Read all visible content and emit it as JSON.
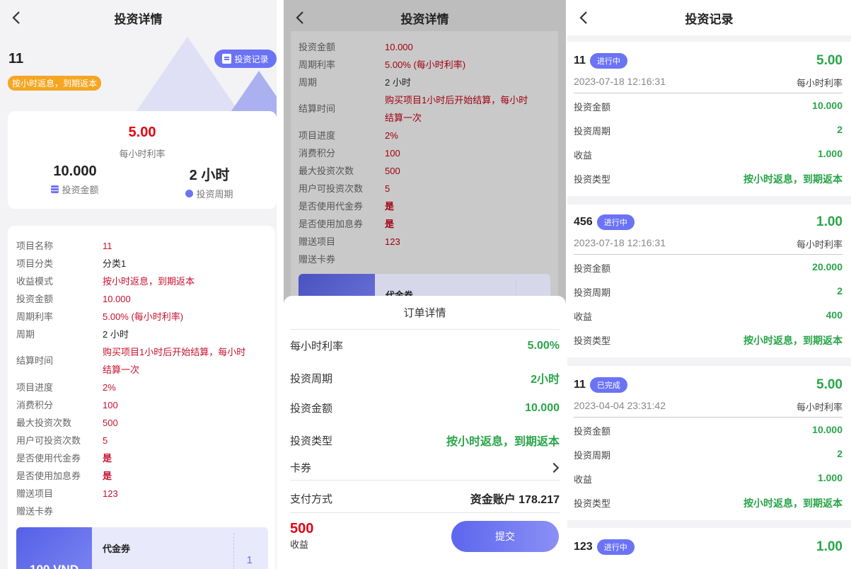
{
  "panel1": {
    "title": "投资详情",
    "name": "11",
    "mode_tag": "按小时返息，到期返本",
    "records_button": "投资记录",
    "rate": "5.00",
    "rate_label": "每小时利率",
    "amount": "10.000",
    "amount_label": "投资金额",
    "period": "2 小时",
    "period_label": "投资周期",
    "details": [
      {
        "k": "项目名称",
        "v": "11"
      },
      {
        "k": "项目分类",
        "v": "分类1"
      },
      {
        "k": "收益模式",
        "v": "按小时返息，到期返本"
      },
      {
        "k": "投资金额",
        "v": "10.000"
      },
      {
        "k": "周期利率",
        "v": "5.00% (每小时利率)"
      },
      {
        "k": "周期",
        "v": "2 小时"
      },
      {
        "k": "结算时间",
        "v1": "购买项目1小时后开始结算，每小时",
        "v2": "结算一次"
      },
      {
        "k": "项目进度",
        "v": "2%"
      },
      {
        "k": "消费积分",
        "v": "100"
      },
      {
        "k": "最大投资次数",
        "v": "500"
      },
      {
        "k": "用户可投资次数",
        "v": "5"
      },
      {
        "k": "是否使用代金券",
        "v": "是"
      },
      {
        "k": "是否使用加息券",
        "v": "是"
      },
      {
        "k": "赠送项目",
        "v": "123"
      },
      {
        "k": "赠送卡券",
        "v": ""
      }
    ],
    "coupon": {
      "value": "100 VND",
      "title": "代金券",
      "count": "1"
    }
  },
  "panel2": {
    "title": "投资详情",
    "details": [
      {
        "k": "投资金额",
        "v": "10.000"
      },
      {
        "k": "周期利率",
        "v": "5.00% (每小时利率)"
      },
      {
        "k": "周期",
        "v": "2 小时"
      },
      {
        "k": "结算时间",
        "v1": "购买项目1小时后开始结算，每小时",
        "v2": "结算一次"
      },
      {
        "k": "项目进度",
        "v": "2%"
      },
      {
        "k": "消费积分",
        "v": "100"
      },
      {
        "k": "最大投资次数",
        "v": "500"
      },
      {
        "k": "用户可投资次数",
        "v": "5"
      },
      {
        "k": "是否使用代金券",
        "v": "是"
      },
      {
        "k": "是否使用加息券",
        "v": "是"
      },
      {
        "k": "赠送项目",
        "v": "123"
      },
      {
        "k": "赠送卡券",
        "v": ""
      }
    ],
    "coupon_title": "代金券",
    "sheet": {
      "title": "订单详情",
      "rows": [
        {
          "k": "每小时利率",
          "v": "5.00%"
        },
        {
          "k": "投资周期",
          "v": "2小时"
        },
        {
          "k": "投资金额",
          "v": "10.000"
        },
        {
          "k": "投资类型",
          "v": "按小时返息，到期返本"
        }
      ],
      "card_label": "卡券",
      "pay_label": "支付方式",
      "pay_value": "资金账户 178.217",
      "total": "500",
      "total_label": "收益",
      "submit": "提交"
    }
  },
  "panel3": {
    "title": "投资记录",
    "rate_label": "每小时利率",
    "labels": {
      "amount": "投资金额",
      "period": "投资周期",
      "income": "收益",
      "type": "投资类型"
    },
    "records": [
      {
        "name": "11",
        "status": "进行中",
        "rate": "5.00",
        "date": "2023-07-18 12:16:31",
        "amount": "10.000",
        "period": "2",
        "income": "1.000",
        "type": "按小时返息，到期返本"
      },
      {
        "name": "456",
        "status": "进行中",
        "rate": "1.00",
        "date": "2023-07-18 12:16:31",
        "amount": "20.000",
        "period": "2",
        "income": "400",
        "type": "按小时返息，到期返本"
      },
      {
        "name": "11",
        "status": "已完成",
        "rate": "5.00",
        "date": "2023-04-04 23:31:42",
        "amount": "10.000",
        "period": "2",
        "income": "1.000",
        "type": "按小时返息，到期返本"
      },
      {
        "name": "123",
        "status": "进行中",
        "rate": "1.00"
      }
    ]
  }
}
